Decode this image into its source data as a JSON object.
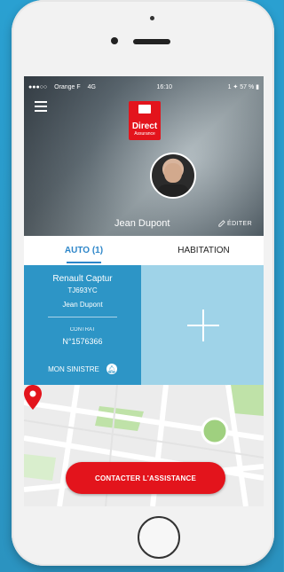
{
  "status_bar": {
    "carrier": "Orange F",
    "network": "4G",
    "time": "16:10",
    "right": "1 ✦ 57 % ▮"
  },
  "brand": {
    "name": "Direct",
    "subtitle": "Assurance"
  },
  "profile": {
    "name": "Jean Dupont",
    "edit_label": "ÉDITER"
  },
  "tabs": [
    {
      "label": "AUTO (1)",
      "active": true
    },
    {
      "label": "HABITATION",
      "active": false
    }
  ],
  "vehicle_card": {
    "model": "Renault Captur",
    "plate": "TJ693YC",
    "owner": "Jean Dupont",
    "contract_label": "CONTRAT",
    "contract_number": "N°1576366",
    "claim_label": "MON SINISTRE"
  },
  "actions": {
    "assistance": "CONTACTER L'ASSISTANCE"
  },
  "colors": {
    "accent_blue": "#2d95c6",
    "light_blue": "#9fd3e8",
    "red": "#e3141c",
    "tab_blue": "#2d86c9"
  }
}
